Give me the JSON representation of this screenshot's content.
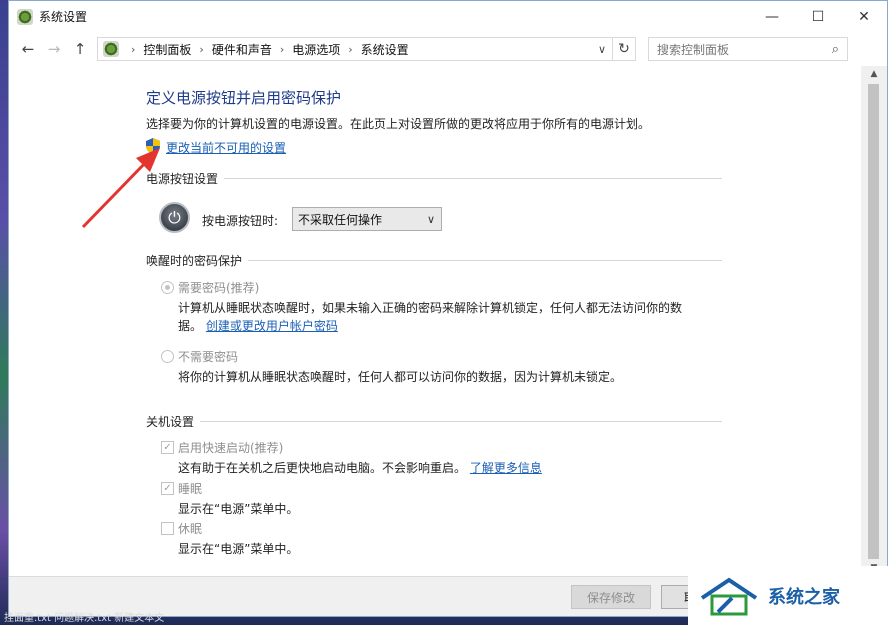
{
  "window": {
    "title": "系统设置"
  },
  "window_controls": {
    "minimize": "—",
    "maximize": "☐",
    "close": "✕"
  },
  "nav": {
    "back": "←",
    "forward": "→",
    "up": "↑"
  },
  "address": {
    "crumbs": [
      "控制面板",
      "硬件和声音",
      "电源选项",
      "系统设置"
    ],
    "separator": "›",
    "dropdown": "∨",
    "refresh": "↻"
  },
  "search": {
    "placeholder": "搜索控制面板",
    "icon": "search-icon"
  },
  "page": {
    "heading": "定义电源按钮并启用密码保护",
    "description": "选择要为你的计算机设置的电源设置。在此页上对设置所做的更改将应用于你所有的电源计划。",
    "change_link": "更改当前不可用的设置"
  },
  "power_section": {
    "title": "电源按钮设置",
    "label": "按电源按钮时:",
    "selected": "不采取任何操作",
    "chevron": "∨"
  },
  "password_section": {
    "title": "唤醒时的密码保护",
    "require_label": "需要密码(推荐)",
    "require_desc1": "计算机从睡眠状态唤醒时，如果未输入正确的密码来解除计算机锁定，任何人都无法访问你的数",
    "require_desc2": "据。",
    "require_link": "创建或更改用户帐户密码",
    "no_require_label": "不需要密码",
    "no_require_desc": "将你的计算机从睡眠状态唤醒时，任何人都可以访问你的数据，因为计算机未锁定。"
  },
  "shutdown_section": {
    "title": "关机设置",
    "fast_label": "启用快速启动(推荐)",
    "fast_desc": "这有助于在关机之后更快地启动电脑。不会影响重启。",
    "fast_link": "了解更多信息",
    "sleep_label": "睡眠",
    "sleep_desc": "显示在“电源”菜单中。",
    "hibernate_label": "休眠",
    "hibernate_desc": "显示在“电源”菜单中。",
    "check_mark": "✓"
  },
  "footer": {
    "save": "保存修改",
    "cancel": "取"
  },
  "watermark": {
    "text": "系统之家"
  },
  "scrollbar": {
    "up": "▲",
    "down": "▼"
  },
  "taskbar_fragment": "挂面重.txt      问题解决.txt    新建文本文"
}
